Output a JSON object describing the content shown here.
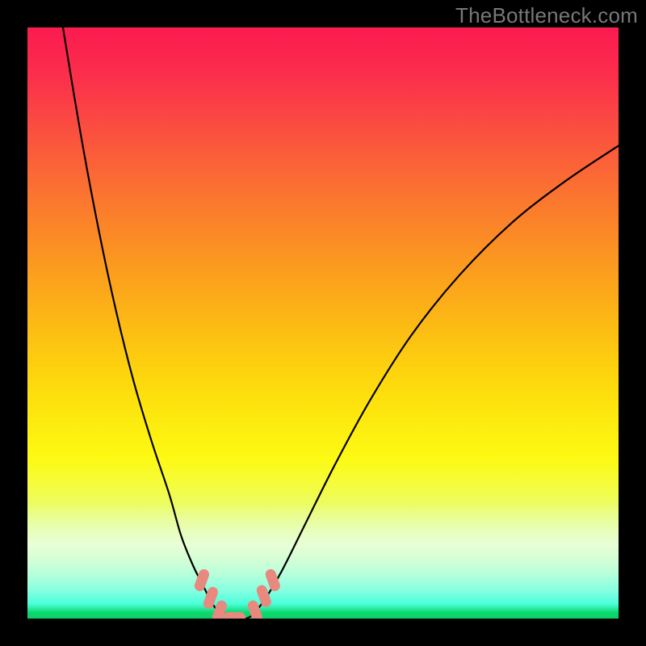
{
  "watermark": "TheBottleneck.com",
  "colors": {
    "page_bg": "#000000",
    "curve_stroke": "#000000",
    "marker_fill": "#e8897f",
    "bottom_green": "#0ece67",
    "top_red": "#fb1b50"
  },
  "chart_data": {
    "type": "line",
    "title": "",
    "xlabel": "",
    "ylabel": "",
    "xlim": [
      0,
      100
    ],
    "ylim": [
      0,
      100
    ],
    "series": [
      {
        "name": "left-curve",
        "x": [
          6,
          9,
          12,
          15,
          18,
          21,
          24,
          26,
          28,
          30,
          31,
          32,
          33
        ],
        "y": [
          100,
          82,
          66,
          52,
          40,
          30,
          21,
          14,
          9,
          5,
          3,
          1.5,
          0.5
        ]
      },
      {
        "name": "right-curve",
        "x": [
          38,
          40,
          43,
          47,
          52,
          58,
          65,
          73,
          82,
          91,
          100
        ],
        "y": [
          0.5,
          3,
          8,
          16,
          26,
          37,
          48,
          58,
          67,
          74,
          80
        ]
      },
      {
        "name": "valley-floor",
        "x": [
          33,
          34,
          35,
          36,
          37,
          38
        ],
        "y": [
          0.5,
          0,
          0,
          0,
          0,
          0.5
        ]
      }
    ],
    "markers": [
      {
        "name": "left-mark-1",
        "x": 29.5,
        "y": 6.5
      },
      {
        "name": "left-mark-2",
        "x": 31.0,
        "y": 3.5
      },
      {
        "name": "left-mark-3",
        "x": 32.5,
        "y": 1.2
      },
      {
        "name": "floor-mark",
        "x": 35.0,
        "y": 0.2
      },
      {
        "name": "right-mark-1",
        "x": 38.5,
        "y": 1.2
      },
      {
        "name": "right-mark-2",
        "x": 40.0,
        "y": 3.8
      },
      {
        "name": "right-mark-3",
        "x": 41.5,
        "y": 6.5
      }
    ],
    "gradient_stops": [
      {
        "pos": 0,
        "color": "#fb1b50"
      },
      {
        "pos": 0.5,
        "color": "#fdd30e"
      },
      {
        "pos": 0.75,
        "color": "#fdfa14"
      },
      {
        "pos": 1.0,
        "color": "#0ece67"
      }
    ]
  }
}
